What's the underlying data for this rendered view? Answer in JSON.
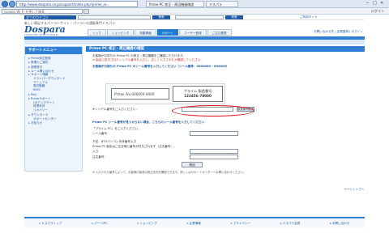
{
  "browser": {
    "url": "http://www.dospara.co.jp/support/index.php?prime_re...",
    "tabs": [
      "Prime PC 修正 - 周辺機器確認",
      "ドスパラ"
    ],
    "controls": [
      "─",
      "□",
      "✕"
    ]
  },
  "toolbar": {
    "google_search": "Google  Wi-Fi を押して検索",
    "login": "ログイン"
  },
  "site": {
    "nav_select": "全てのカテゴリ",
    "nav_search_btn": "検索",
    "nav_btn2": "検索",
    "nav_help": "ご利用ガイド",
    "tagline": "新しい満足するパソコンサイト・パソコンの通販専門ドスパラ",
    "logo": "Dospara",
    "logo_sub": "COMPUTER SHOP DOSPARA",
    "tabs": [
      "トップ",
      "ショッピング",
      "特集情報",
      "サポート",
      "ユーザー登録",
      "ご注文履歴"
    ],
    "user_links": "お問い合わせ先 | 会員登録 | ログイン"
  },
  "sidebar": {
    "title": "サポートメニュー",
    "items": [
      "Prime修正登録",
      "修理のご案内",
      "修理受付",
      "メール問い合わせ",
      "サポート情報",
      "FAQ",
      "Primeサポート",
      "ダウンロード",
      "お知らせ"
    ],
    "subitems": [
      "ドライバーダウンロード",
      "マニュアル",
      "周辺機器",
      "BIOS",
      "OSアップデート",
      "修理状況",
      "リカバリー",
      "サポートセンター"
    ]
  },
  "main": {
    "title": "Prime PC 修正・周辺機器の確認",
    "intro1": "お客様がお持ちの Prime PC の修正・周辺機器をご確認いただけます。",
    "intro2": "※ 製品に貼付されたシリアル番号を入力し、正しく入力されたか確認してください。",
    "intro3": "お客様がお持ちの Prime PC のシール番号を入力してください（シール番号：0000000 - 000000）",
    "card_text": "Prime No.000000-0000",
    "card2_line1": "プライム 製造番号",
    "card2_line2": "123456-78000",
    "reg_label": "※シリアル番号をご入力ください：",
    "reg_btn": "製造番号確認",
    "section2": "Prime PC シール番号が見つからない場合、こちらのシール番号を入力してください",
    "f1": "「プライム PC」をご入力ください。",
    "f2": "シール番号：",
    "f3": "下記、BTOパソコン本体番号入力",
    "f4": "Prime PC 製品はご注文時に番号が付与されます（注文番号）。",
    "f5": "入力",
    "f6": "注文番号：",
    "submit": "確認",
    "foot_note": "※ 入力された番号によって、お客様の製品の修正状況を確認できます。詳しくはサポートセンターへお問い合わせください。",
    "back": "ページトップへ"
  },
  "footer": {
    "links": [
      "ドスパラトップ",
      "パーツ/PC",
      "ショッピング",
      "企業情報",
      "プライバシー",
      "ドスパラ会員",
      "お問い合わせ"
    ]
  }
}
